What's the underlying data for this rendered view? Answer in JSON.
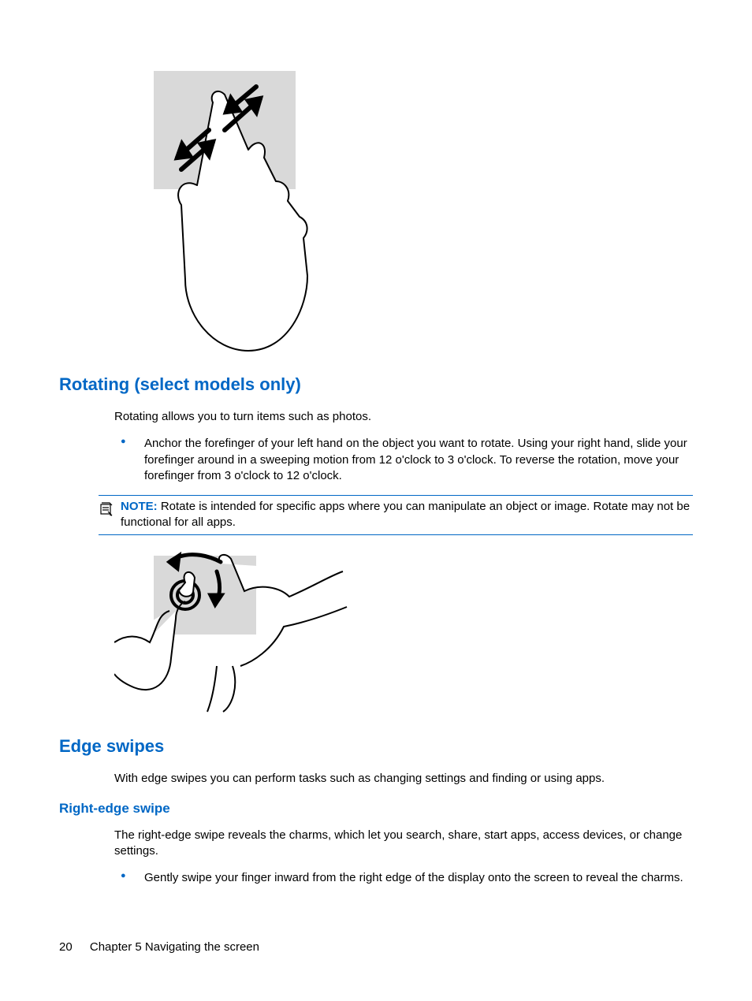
{
  "sections": {
    "rotating": {
      "heading": "Rotating (select models only)",
      "intro": "Rotating allows you to turn items such as photos.",
      "bullet": "Anchor the forefinger of your left hand on the object you want to rotate. Using your right hand, slide your forefinger around in a sweeping motion from 12 o'clock to 3 o'clock. To reverse the rotation, move your forefinger from 3 o'clock to 12 o'clock.",
      "note_label": "NOTE:",
      "note_text": "Rotate is intended for specific apps where you can manipulate an object or image. Rotate may not be functional for all apps."
    },
    "edge_swipes": {
      "heading": "Edge swipes",
      "intro": "With edge swipes you can perform tasks such as changing settings and finding or using apps."
    },
    "right_edge_swipe": {
      "heading": "Right-edge swipe",
      "intro": "The right-edge swipe reveals the charms, which let you search, share, start apps, access devices, or change settings.",
      "bullet": "Gently swipe your finger inward from the right edge of the display onto the screen to reveal the charms."
    }
  },
  "footer": {
    "page_number": "20",
    "chapter": "Chapter 5   Navigating the screen"
  }
}
